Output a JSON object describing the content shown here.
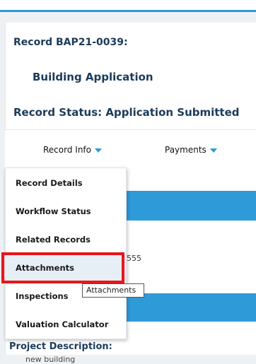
{
  "record": {
    "title": "Record BAP21-0039:",
    "type": "Building Application",
    "status": "Record Status: Application Submitted"
  },
  "tabs": [
    {
      "label": "Record Info",
      "icon": "chevron-down-icon"
    },
    {
      "label": "Payments",
      "icon": "chevron-down-icon"
    }
  ],
  "menu": {
    "items": [
      {
        "label": "Record Details"
      },
      {
        "label": "Workflow Status"
      },
      {
        "label": "Related Records"
      },
      {
        "label": "Attachments"
      },
      {
        "label": "Inspections"
      },
      {
        "label": "Valuation Calculator"
      }
    ]
  },
  "tooltip": "Attachments",
  "partial_text": "555",
  "project": {
    "label": "Project Description:",
    "value": "new building"
  },
  "colors": {
    "accent": "#2e9ad8",
    "highlight_box": "#e8141c",
    "text_primary": "#1b3b5a"
  }
}
